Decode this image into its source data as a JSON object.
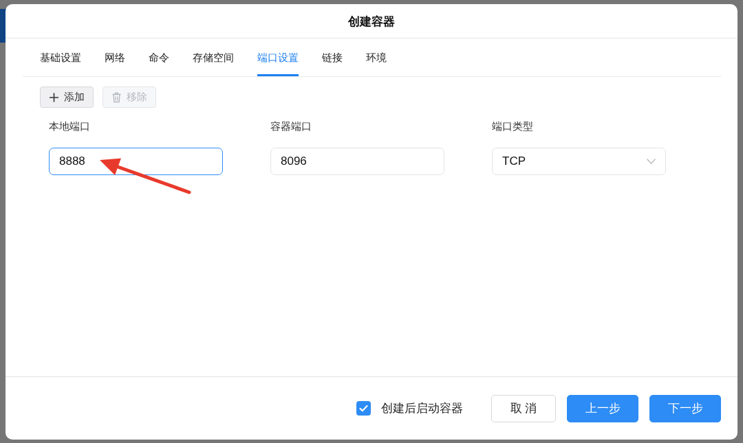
{
  "dialog": {
    "title": "创建容器"
  },
  "tabs": [
    {
      "label": "基础设置",
      "selected": false
    },
    {
      "label": "网络",
      "selected": false
    },
    {
      "label": "命令",
      "selected": false
    },
    {
      "label": "存储空间",
      "selected": false
    },
    {
      "label": "端口设置",
      "selected": true
    },
    {
      "label": "链接",
      "selected": false
    },
    {
      "label": "环境",
      "selected": false
    }
  ],
  "toolbar": [
    {
      "label": "添加",
      "kind": "add",
      "disabled": false
    },
    {
      "label": "移除",
      "kind": "remove",
      "disabled": true
    }
  ],
  "port_fields": [
    {
      "label": "本地端口",
      "value": "8888",
      "kind": "text",
      "focused": true
    },
    {
      "label": "容器端口",
      "value": "8096",
      "kind": "text",
      "focused": false
    },
    {
      "label": "端口类型",
      "value": "TCP",
      "kind": "select",
      "focused": false
    }
  ],
  "footer": {
    "start_after_create": {
      "label": "创建后启动容器",
      "checked": true
    },
    "buttons": [
      {
        "label": "取 消",
        "kind": "secondary"
      },
      {
        "label": "上一步",
        "kind": "primary"
      },
      {
        "label": "下一步",
        "kind": "primary"
      }
    ]
  }
}
